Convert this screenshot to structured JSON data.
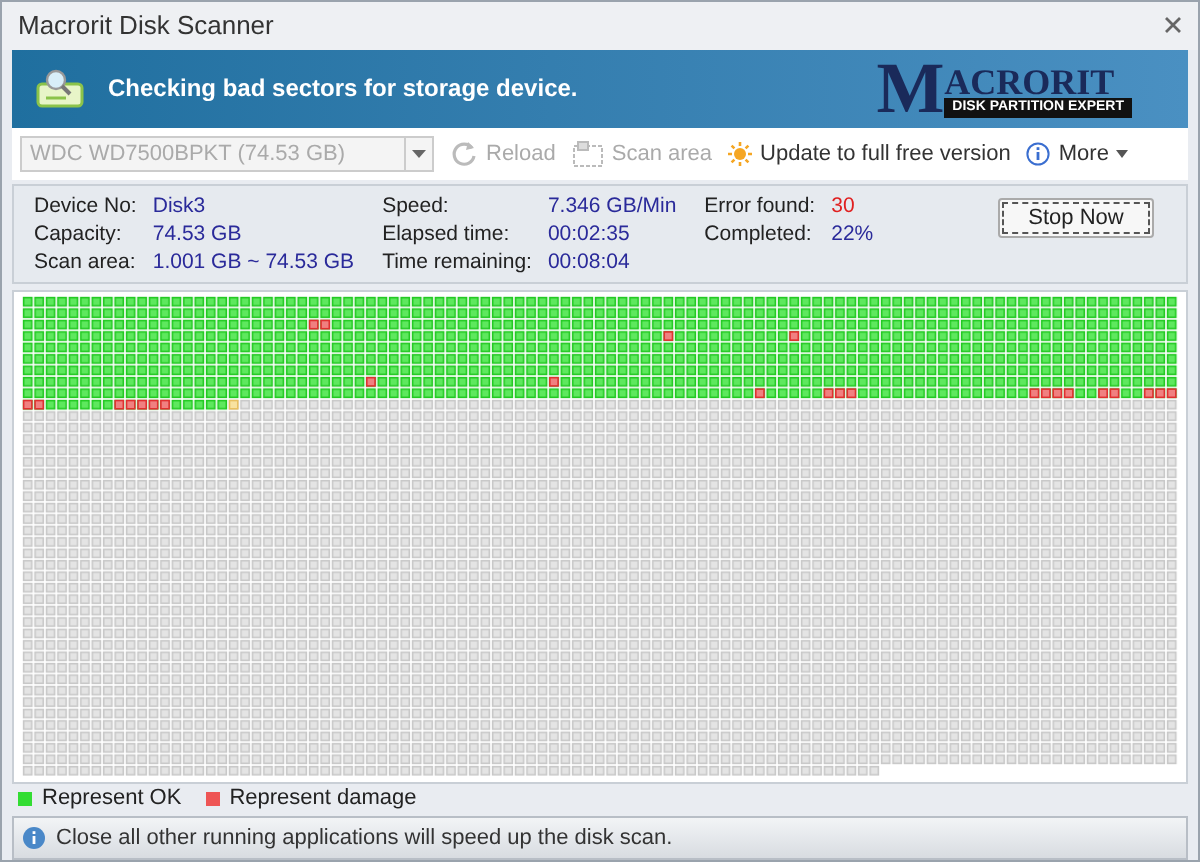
{
  "window": {
    "title": "Macrorit Disk Scanner"
  },
  "banner": {
    "message": "Checking bad sectors for storage device.",
    "logo_title": "ACRORIT",
    "logo_initial": "M",
    "logo_subtitle": "DISK PARTITION EXPERT"
  },
  "toolbar": {
    "device_select": {
      "value": "WDC WD7500BPKT (74.53 GB)",
      "disabled": true
    },
    "items": [
      {
        "label": "Reload",
        "kind": "reload",
        "disabled": true
      },
      {
        "label": "Scan area",
        "kind": "scan-area",
        "disabled": true
      },
      {
        "label": "Update to full free version",
        "kind": "update",
        "disabled": false
      },
      {
        "label": "More",
        "kind": "more",
        "disabled": false
      }
    ]
  },
  "info": {
    "columns": [
      [
        {
          "label": "Device No:",
          "value": "Disk3"
        },
        {
          "label": "Capacity:",
          "value": "74.53 GB"
        },
        {
          "label": "Scan area:",
          "value": "1.001 GB ~ 74.53 GB"
        }
      ],
      [
        {
          "label": "Speed:",
          "value": "7.346 GB/Min"
        },
        {
          "label": "Elapsed time:",
          "value": "00:02:35"
        },
        {
          "label": "Time remaining:",
          "value": "00:08:04"
        }
      ],
      [
        {
          "label": "Error found:",
          "value": "30",
          "kind": "error"
        },
        {
          "label": "Completed:",
          "value": "22%"
        }
      ]
    ],
    "stop_button": "Stop Now"
  },
  "legend": [
    {
      "label": "Represent OK",
      "color": "#33dd33"
    },
    {
      "label": "Represent damage",
      "color": "#ee5555"
    }
  ],
  "status_bar": {
    "message": "Close all other running applications will speed up the disk scan."
  }
}
